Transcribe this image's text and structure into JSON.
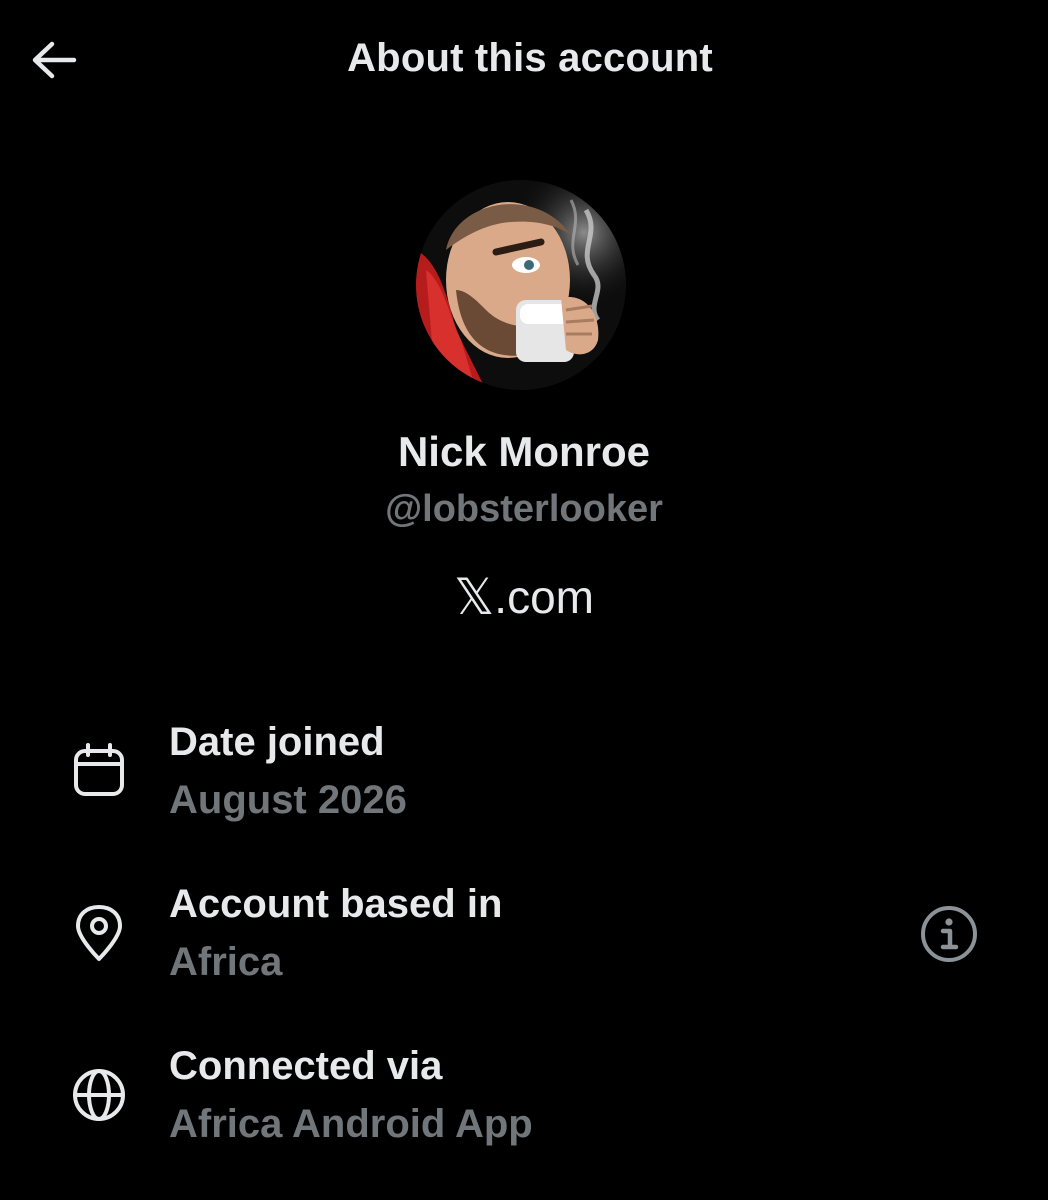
{
  "header": {
    "title": "About this account",
    "back_icon": "arrow-left-icon"
  },
  "profile": {
    "name": "Nick Monroe",
    "handle": "@lobsterlooker",
    "avatar_description_icon": "avatar"
  },
  "brand": {
    "x_glyph": "𝕏",
    "domain": ".com"
  },
  "details": [
    {
      "icon": "calendar-icon",
      "label": "Date joined",
      "value": "August 2026"
    },
    {
      "icon": "location-pin-icon",
      "label": "Account based in",
      "value": "Africa",
      "info_icon": "info-icon"
    },
    {
      "icon": "globe-icon",
      "label": "Connected via",
      "value": "Africa Android App"
    }
  ],
  "colors": {
    "background": "#000000",
    "primary_text": "#e7e9ea",
    "secondary_text": "#71767b"
  }
}
